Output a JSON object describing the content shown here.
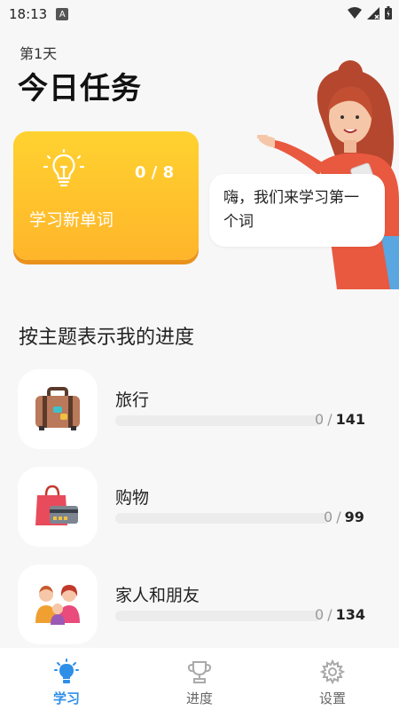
{
  "status": {
    "time": "18:13"
  },
  "header": {
    "day": "第1天",
    "title": "今日任务"
  },
  "task_card": {
    "count": "0 / 8",
    "label": "学习新单词"
  },
  "bubble": {
    "text": "嗨，我们来学习第一个词"
  },
  "section": {
    "title": "按主题表示我的进度"
  },
  "topics": [
    {
      "name": "旅行",
      "done": "0",
      "sep": "/",
      "total": "141",
      "icon": "suitcase-icon"
    },
    {
      "name": "购物",
      "done": "0",
      "sep": "/",
      "total": "99",
      "icon": "shopping-bag-icon"
    },
    {
      "name": "家人和朋友",
      "done": "0",
      "sep": "/",
      "total": "134",
      "icon": "family-icon"
    }
  ],
  "tabs": [
    {
      "label": "学习",
      "icon": "bulb-icon",
      "active": true
    },
    {
      "label": "进度",
      "icon": "trophy-icon",
      "active": false
    },
    {
      "label": "设置",
      "icon": "gear-icon",
      "active": false
    }
  ],
  "colors": {
    "accent": "#2f8fe8",
    "card_top": "#ffd230",
    "card_bottom": "#ffb52a"
  }
}
